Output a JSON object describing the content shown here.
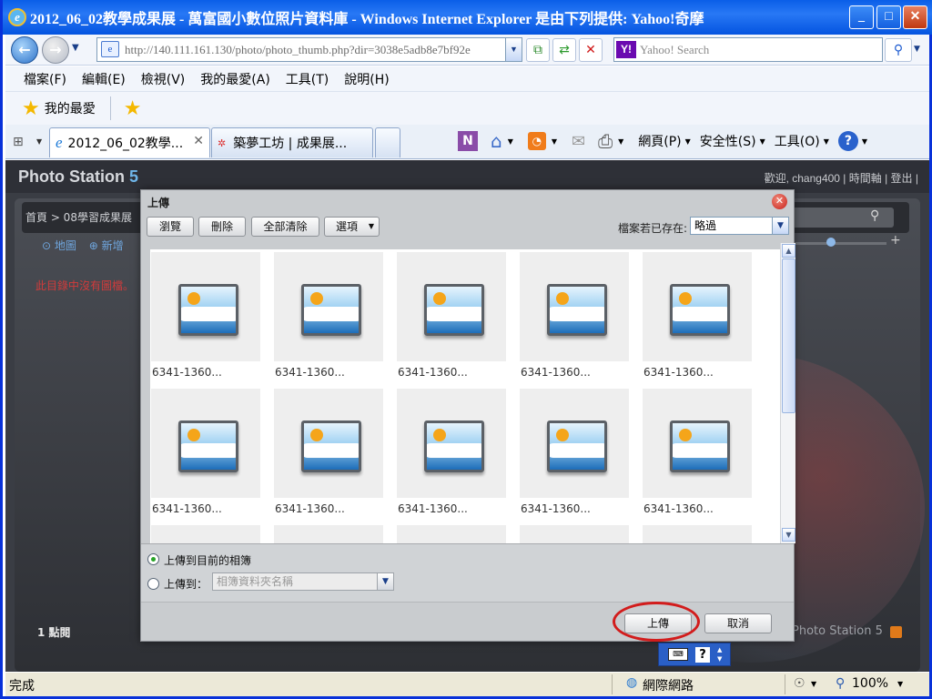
{
  "window": {
    "title": "2012_06_02教學成果展 - 萬富國小數位照片資料庫 - Windows Internet Explorer 是由下列提供: Yahoo!奇摩",
    "minimize": "_",
    "maximize": "□",
    "close": "✕"
  },
  "nav": {
    "address": "http://140.111.161.130/photo/photo_thumb.php?dir=3038e5adb8e7bf92e",
    "search_placeholder": "Yahoo! Search",
    "yahoo": "Y!"
  },
  "menu": [
    "檔案(F)",
    "編輯(E)",
    "檢視(V)",
    "我的最愛(A)",
    "工具(T)",
    "說明(H)"
  ],
  "favorites": {
    "label": "我的最愛"
  },
  "tabs": [
    {
      "label": "2012_06_02教學..."
    },
    {
      "label": "築夢工坊 | 成果展..."
    }
  ],
  "commands": {
    "page": "網頁(P)",
    "safety": "安全性(S)",
    "tools": "工具(O)"
  },
  "photostation": {
    "logo": "Photo Station",
    "logo_num": "5",
    "welcome": "歡迎, chang400 | 時間軸 | 登出 |",
    "breadcrumb": "首頁 > 08學習成果展",
    "tool_map": "地圖",
    "tool_add": "新增",
    "empty_msg": "此目錄中沒有圖檔。",
    "count": "1 點閱",
    "footer": "Photo Station 5"
  },
  "dialog": {
    "title": "上傳",
    "buttons": {
      "browse": "瀏覽",
      "delete": "刪除",
      "clear_all": "全部清除",
      "options": "選項"
    },
    "exists_label": "檔案若已存在:",
    "exists_value": "略過",
    "thumbnails": [
      "6341-1360...",
      "6341-1360...",
      "6341-1360...",
      "6341-1360...",
      "6341-1360...",
      "6341-1360...",
      "6341-1360...",
      "6341-1360...",
      "6341-1360...",
      "6341-1360..."
    ],
    "upload_current": "上傳到目前的相簿",
    "upload_to": "上傳到：",
    "folder_placeholder": "相簿資料夾名稱",
    "upload_button": "上傳",
    "cancel_button": "取消"
  },
  "status": {
    "left": "完成",
    "zone": "網際網路",
    "zoom": "100%"
  }
}
